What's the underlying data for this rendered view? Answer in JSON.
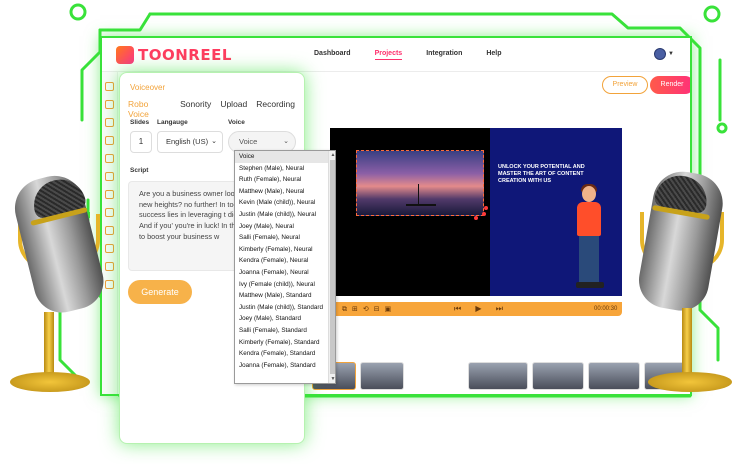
{
  "brand": {
    "name": "TOONREEL"
  },
  "nav": {
    "links": [
      "Dashboard",
      "Projects",
      "Integration",
      "Help"
    ],
    "active": "Projects"
  },
  "header_actions": {
    "preview": "Preview",
    "render": "Render"
  },
  "voiceover": {
    "title": "Voiceover",
    "tabs": [
      "Robo Voice",
      "Sonority",
      "Upload",
      "Recording"
    ],
    "active_tab": "Robo Voice",
    "slides_label": "Slides",
    "slides_value": "1",
    "language_label": "Langauge",
    "language_value": "English (US)",
    "voice_label": "Voice",
    "voice_value": "Voice",
    "script_label": "Script",
    "script_text": "Are you a business owner loo your business to new heights? no further! In today's digital s to success lies in leveraging t digital marketing. And if you' you're in luck! In this video, w how to boost your business w",
    "generate": "Generate"
  },
  "voice_options": [
    "Voice",
    "Stephen (Male), Neural",
    "Ruth (Female), Neural",
    "Matthew (Male), Neural",
    "Kevin (Male (child)), Neural",
    "Justin (Male (child)), Neural",
    "Joey (Male), Neural",
    "Salli (Female), Neural",
    "Kimberly (Female), Neural",
    "Kendra (Female), Neural",
    "Joanna (Female), Neural",
    "Ivy (Female (child)), Neural",
    "Matthew (Male), Standard",
    "Justin (Male (child)), Standard",
    "Joey (Male), Standard",
    "Salli (Female), Standard",
    "Kimberly (Female), Standard",
    "Kendra (Female), Standard",
    "Joanna (Female), Standard"
  ],
  "canvas": {
    "heading": "UNLOCK YOUR POTENTIAL AND MASTER THE ART OF CONTENT CREATION WITH US",
    "time": "00:00:30"
  },
  "colors": {
    "accent": "#f2a33a",
    "brand": "#ff2f6d",
    "neon": "#39e23a",
    "slide_bg": "#0f1778"
  }
}
